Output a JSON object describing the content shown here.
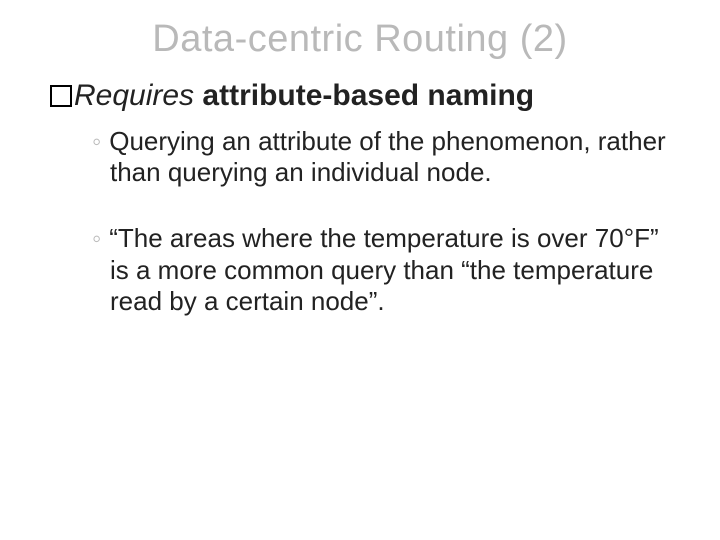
{
  "title": "Data-centric Routing (2)",
  "lead": {
    "requires": "Requires",
    "attribute_based": "attribute-based naming"
  },
  "subs": [
    "Querying an attribute of the phenomenon, rather than querying an individual node.",
    "“The areas where the temperature is over 70°F” is a more common query than “the temperature read by a certain node”."
  ]
}
